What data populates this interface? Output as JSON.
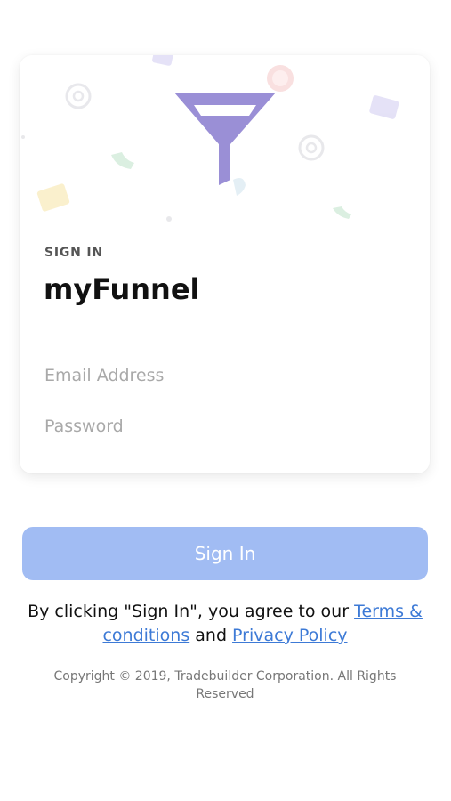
{
  "colors": {
    "accent": "#a1bcf3",
    "link": "#3d7ad6",
    "funnel": "#9a8fd6"
  },
  "card": {
    "eyebrow": "SIGN IN",
    "title": "myFunnel",
    "logo_icon": "funnel-icon"
  },
  "form": {
    "email_placeholder": "Email Address",
    "password_placeholder": "Password",
    "submit_label": "Sign In"
  },
  "legal": {
    "prefix": "By clicking \"Sign In\", you agree to our ",
    "terms_link": "Terms & conditions",
    "middle": " and ",
    "privacy_link": "Privacy Policy"
  },
  "footer": {
    "copyright": "Copyright © 2019, Tradebuilder Corporation. All Rights Reserved"
  }
}
